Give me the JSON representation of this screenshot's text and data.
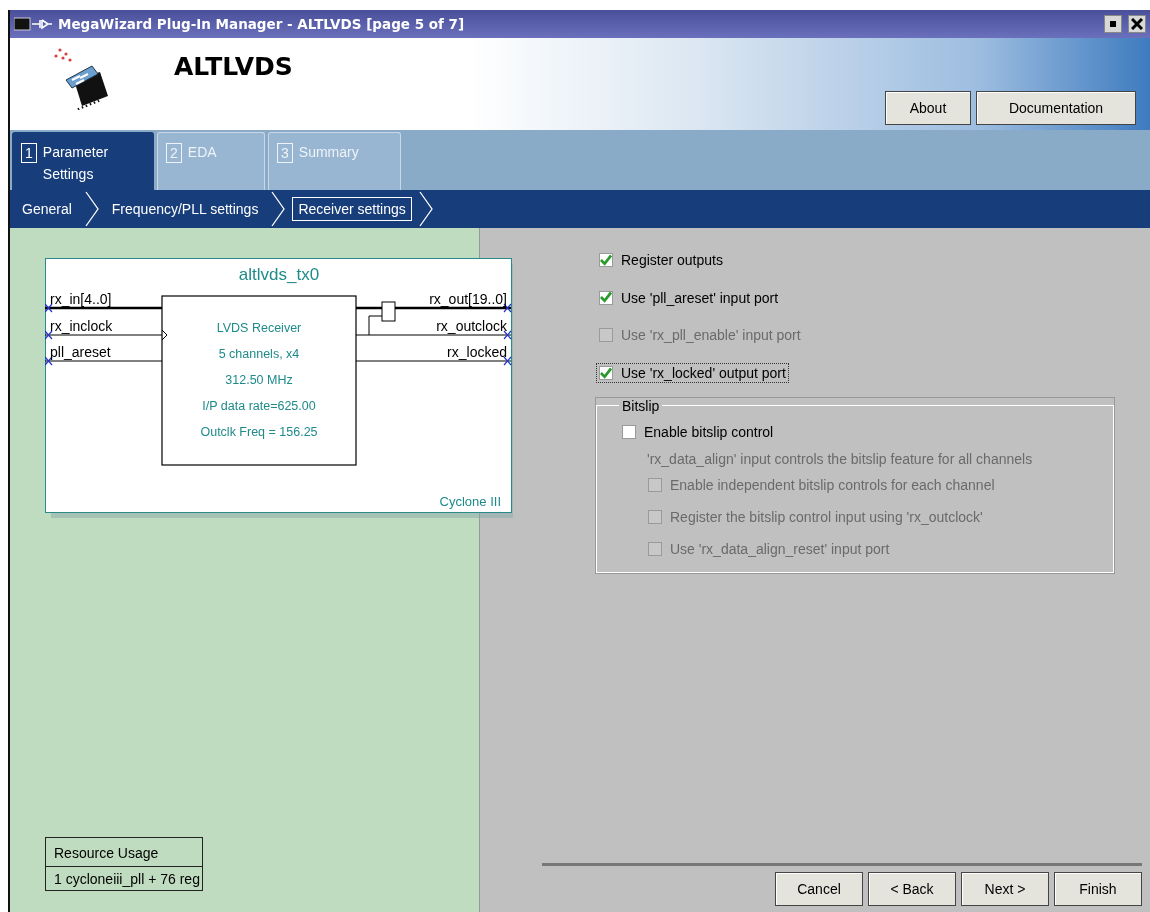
{
  "window": {
    "title": "MegaWizard Plug-In Manager - ALTLVDS [page 5 of 7]"
  },
  "header": {
    "title": "ALTLVDS",
    "buttons": [
      "About",
      "Documentation"
    ]
  },
  "tabs": [
    {
      "number": "1",
      "label": "Parameter Settings",
      "selected": true
    },
    {
      "number": "2",
      "label": "EDA",
      "selected": false
    },
    {
      "number": "3",
      "label": "Summary",
      "selected": false
    }
  ],
  "breadcrumb": [
    {
      "label": "General",
      "selected": false
    },
    {
      "label": "Frequency/PLL settings",
      "selected": false
    },
    {
      "label": "Receiver settings",
      "selected": true
    }
  ],
  "diagram": {
    "title": "altlvds_tx0",
    "inputs": [
      "rx_in[4..0]",
      "rx_inclock",
      "pll_areset"
    ],
    "outputs": [
      "rx_out[19..0]",
      "rx_outclock",
      "rx_locked"
    ],
    "block_lines": [
      "LVDS Receiver",
      "5 channels, x4",
      "312.50 MHz",
      "I/P data rate=625.00",
      "Outclk Freq = 156.25"
    ],
    "device": "Cyclone III"
  },
  "resource_usage": {
    "title": "Resource Usage",
    "value": "1 cycloneiii_pll + 76 reg"
  },
  "options": [
    {
      "label": "Register outputs",
      "checked": true,
      "disabled": false,
      "focused": false
    },
    {
      "label": "Use 'pll_areset' input port",
      "checked": true,
      "disabled": false,
      "focused": false
    },
    {
      "label": "Use 'rx_pll_enable' input port",
      "checked": false,
      "disabled": true,
      "focused": false
    },
    {
      "label": "Use 'rx_locked' output port",
      "checked": true,
      "disabled": false,
      "focused": true
    }
  ],
  "bitslip": {
    "title": "Bitslip",
    "enable": {
      "label": "Enable bitslip control",
      "checked": false,
      "disabled": false
    },
    "description": "'rx_data_align' input controls the bitslip feature for all channels",
    "options": [
      {
        "label": "Enable independent bitslip controls for each channel",
        "checked": false,
        "disabled": true
      },
      {
        "label": "Register the bitslip control input using 'rx_outclock'",
        "checked": false,
        "disabled": true
      },
      {
        "label": "Use 'rx_data_align_reset' input port",
        "checked": false,
        "disabled": true
      }
    ]
  },
  "footer_buttons": [
    "Cancel",
    "< Back",
    "Next >",
    "Finish"
  ]
}
